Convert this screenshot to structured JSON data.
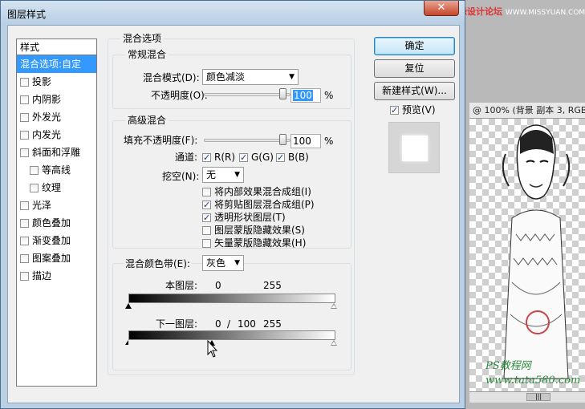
{
  "window": {
    "title": "图层样式",
    "close_glyph": "✕"
  },
  "watermark": {
    "top": "思缘设计论坛",
    "top_url": "WWW.MISSYUAN.COM",
    "bottom_line1": "PS教程网",
    "bottom_line2": "www.tata580.com"
  },
  "background_doc": {
    "title": "@ 100% (背景 副本 3, RGB"
  },
  "style_list": {
    "header": "样式",
    "items": [
      {
        "label": "混合选项:自定",
        "checkbox": false,
        "checked": false,
        "selected": true,
        "indent": false
      },
      {
        "label": "投影",
        "checkbox": true,
        "checked": false,
        "selected": false,
        "indent": false
      },
      {
        "label": "内阴影",
        "checkbox": true,
        "checked": false,
        "selected": false,
        "indent": false
      },
      {
        "label": "外发光",
        "checkbox": true,
        "checked": false,
        "selected": false,
        "indent": false
      },
      {
        "label": "内发光",
        "checkbox": true,
        "checked": false,
        "selected": false,
        "indent": false
      },
      {
        "label": "斜面和浮雕",
        "checkbox": true,
        "checked": false,
        "selected": false,
        "indent": false
      },
      {
        "label": "等高线",
        "checkbox": true,
        "checked": false,
        "selected": false,
        "indent": true
      },
      {
        "label": "纹理",
        "checkbox": true,
        "checked": false,
        "selected": false,
        "indent": true
      },
      {
        "label": "光泽",
        "checkbox": true,
        "checked": false,
        "selected": false,
        "indent": false
      },
      {
        "label": "颜色叠加",
        "checkbox": true,
        "checked": false,
        "selected": false,
        "indent": false
      },
      {
        "label": "渐变叠加",
        "checkbox": true,
        "checked": false,
        "selected": false,
        "indent": false
      },
      {
        "label": "图案叠加",
        "checkbox": true,
        "checked": false,
        "selected": false,
        "indent": false
      },
      {
        "label": "描边",
        "checkbox": true,
        "checked": false,
        "selected": false,
        "indent": false
      }
    ]
  },
  "blend_options": {
    "title": "混合选项",
    "general": {
      "title": "常规混合",
      "mode_label": "混合模式(D):",
      "mode_value": "颜色减淡",
      "opacity_label": "不透明度(O):",
      "opacity_value": "100",
      "opacity_percent": 1.0,
      "unit": "%"
    },
    "advanced": {
      "title": "高级混合",
      "fill_label": "填充不透明度(F):",
      "fill_value": "100",
      "fill_percent": 1.0,
      "unit": "%",
      "channels_label": "通道:",
      "channel_r": "R(R)",
      "channel_g": "G(G)",
      "channel_b": "B(B)",
      "knockout_label": "挖空(N):",
      "knockout_value": "无",
      "options": [
        {
          "label": "将内部效果混合成组(I)",
          "checked": false
        },
        {
          "label": "将剪贴图层混合成组(P)",
          "checked": true
        },
        {
          "label": "透明形状图层(T)",
          "checked": true
        },
        {
          "label": "图层蒙版隐藏效果(S)",
          "checked": false
        },
        {
          "label": "矢量蒙版隐藏效果(H)",
          "checked": false
        }
      ]
    },
    "blend_if": {
      "label": "混合颜色带(E):",
      "value": "灰色",
      "this_layer_label": "本图层:",
      "this_layer_low": "0",
      "this_layer_high": "255",
      "underlying_label": "下一图层:",
      "underlying_low": "0",
      "underlying_sep": "/",
      "underlying_split": "100",
      "underlying_high": "255"
    }
  },
  "buttons": {
    "ok": "确定",
    "reset": "复位",
    "new_style": "新建样式(W)...",
    "preview_label": "预览(V)",
    "preview_checked": true
  }
}
